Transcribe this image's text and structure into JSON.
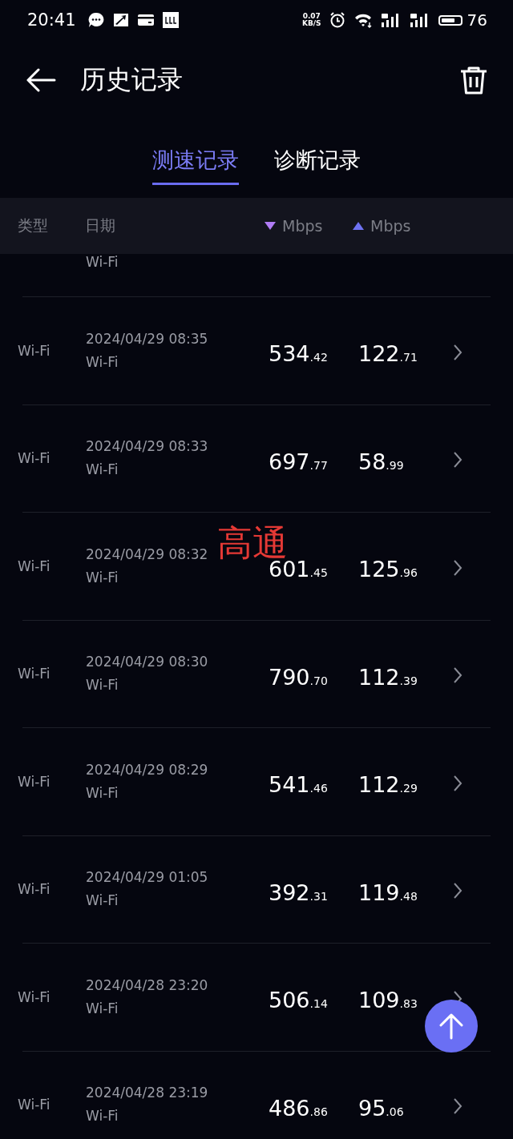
{
  "status_bar": {
    "time": "20:41",
    "net_speed": "0.07",
    "net_unit": "KB/S",
    "battery": "76"
  },
  "header": {
    "title": "历史记录"
  },
  "tabs": [
    {
      "label": "测速记录",
      "selected": true
    },
    {
      "label": "诊断记录",
      "selected": false
    }
  ],
  "table": {
    "columns": [
      {
        "label": "类型",
        "kind": "plain"
      },
      {
        "label": "日期",
        "kind": "plain"
      },
      {
        "label": "Mbps",
        "kind": "down"
      },
      {
        "label": "Mbps",
        "kind": "up"
      }
    ],
    "partial_row": {
      "network": "Wi-Fi"
    },
    "rows": [
      {
        "type": "Wi-Fi",
        "date": "2024/04/29 08:35",
        "network": "Wi-Fi",
        "down": "534",
        "down_frac": ".42",
        "up": "122",
        "up_frac": ".71"
      },
      {
        "type": "Wi-Fi",
        "date": "2024/04/29 08:33",
        "network": "Wi-Fi",
        "down": "697",
        "down_frac": ".77",
        "up": "58",
        "up_frac": ".99"
      },
      {
        "type": "Wi-Fi",
        "date": "2024/04/29 08:32",
        "network": "Wi-Fi",
        "down": "601",
        "down_frac": ".45",
        "up": "125",
        "up_frac": ".96"
      },
      {
        "type": "Wi-Fi",
        "date": "2024/04/29 08:30",
        "network": "Wi-Fi",
        "down": "790",
        "down_frac": ".70",
        "up": "112",
        "up_frac": ".39"
      },
      {
        "type": "Wi-Fi",
        "date": "2024/04/29 08:29",
        "network": "Wi-Fi",
        "down": "541",
        "down_frac": ".46",
        "up": "112",
        "up_frac": ".29"
      },
      {
        "type": "Wi-Fi",
        "date": "2024/04/29 01:05",
        "network": "Wi-Fi",
        "down": "392",
        "down_frac": ".31",
        "up": "119",
        "up_frac": ".48"
      },
      {
        "type": "Wi-Fi",
        "date": "2024/04/28 23:20",
        "network": "Wi-Fi",
        "down": "506",
        "down_frac": ".14",
        "up": "109",
        "up_frac": ".83"
      },
      {
        "type": "Wi-Fi",
        "date": "2024/04/28 23:19",
        "network": "Wi-Fi",
        "down": "486",
        "down_frac": ".86",
        "up": "95",
        "up_frac": ".06"
      }
    ]
  },
  "annotation": {
    "text": "高通"
  }
}
